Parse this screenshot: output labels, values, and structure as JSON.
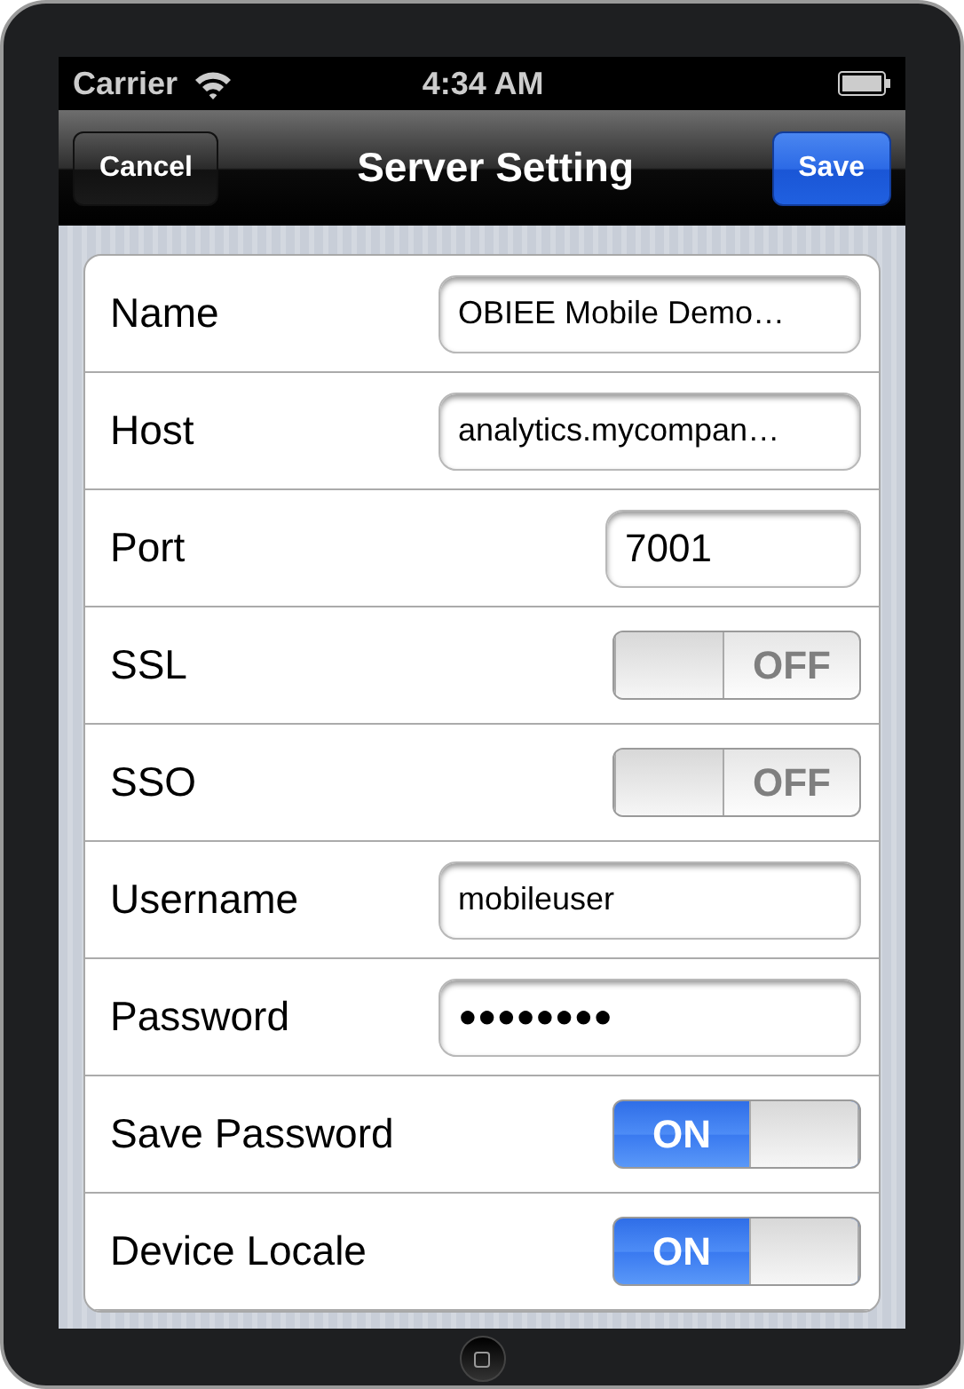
{
  "status_bar": {
    "carrier": "Carrier",
    "time": "4:34 AM"
  },
  "nav_bar": {
    "title": "Server Setting",
    "left_button": "Cancel",
    "right_button": "Save"
  },
  "rows": [
    {
      "kind": "text",
      "label": "Name",
      "value": "OBIEE Mobile Demo…"
    },
    {
      "kind": "text",
      "label": "Host",
      "value": "analytics.mycompan…"
    },
    {
      "kind": "number",
      "label": "Port",
      "value": "7001"
    },
    {
      "kind": "switch",
      "label": "SSL",
      "on": false,
      "switch_text": "OFF"
    },
    {
      "kind": "switch",
      "label": "SSO",
      "on": false,
      "switch_text": "OFF"
    },
    {
      "kind": "text",
      "label": "Username",
      "value": "mobileuser"
    },
    {
      "kind": "text",
      "label": "Password",
      "value": "●●●●●●●●"
    },
    {
      "kind": "switch",
      "label": "Save Password",
      "on": true,
      "switch_text": "ON"
    },
    {
      "kind": "switch",
      "label": "Device Locale",
      "on": true,
      "switch_text": "ON"
    }
  ]
}
